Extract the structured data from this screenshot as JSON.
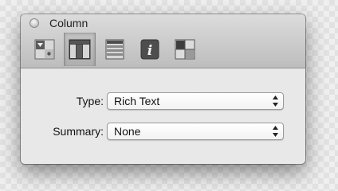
{
  "window": {
    "title": "Column"
  },
  "toolbar": {
    "tabs": [
      {
        "name": "style-icon",
        "selected": false
      },
      {
        "name": "column-icon",
        "selected": true
      },
      {
        "name": "table-icon",
        "selected": false
      },
      {
        "name": "info-icon",
        "selected": false
      },
      {
        "name": "grid-icon",
        "selected": false
      }
    ]
  },
  "form": {
    "type_label": "Type:",
    "type_value": "Rich Text",
    "summary_label": "Summary:",
    "summary_value": "None"
  }
}
